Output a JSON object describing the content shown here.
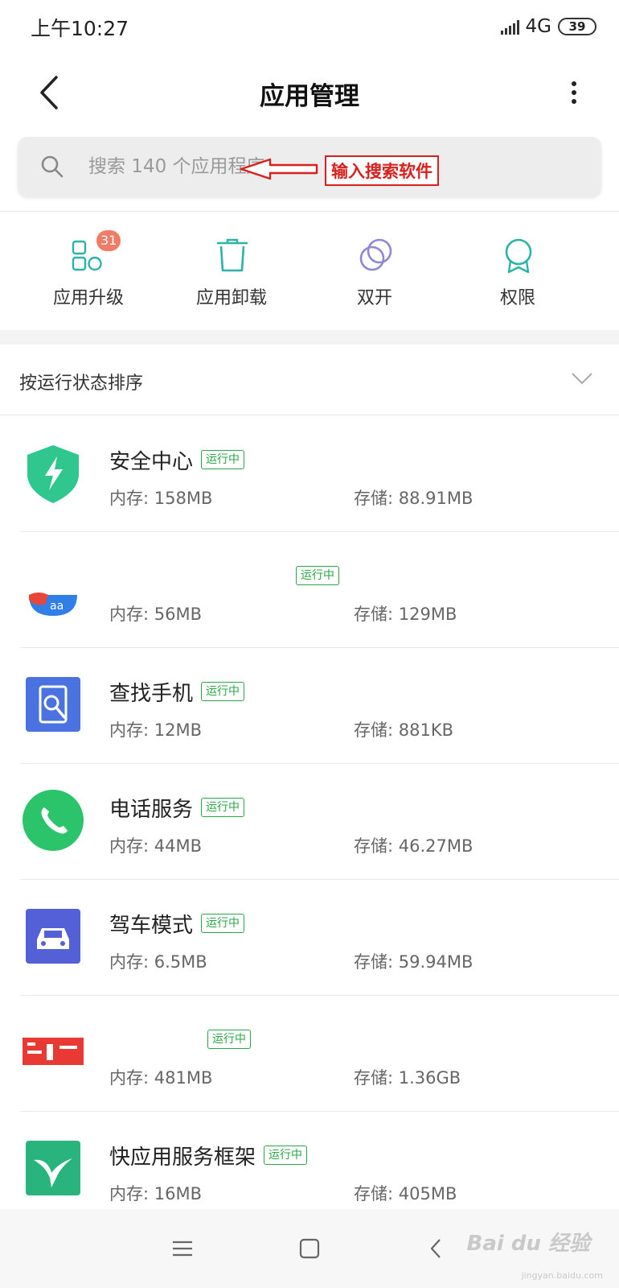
{
  "status_bar": {
    "time": "上午10:27",
    "network": "4G",
    "battery": "39"
  },
  "header": {
    "title": "应用管理"
  },
  "search": {
    "placeholder": "搜索 140 个应用程序"
  },
  "annotation": {
    "label": "输入搜索软件",
    "color": "#d9201c"
  },
  "quick_actions": [
    {
      "label": "应用升级",
      "icon": "app-grid-icon",
      "badge": "31"
    },
    {
      "label": "应用卸载",
      "icon": "trash-icon"
    },
    {
      "label": "双开",
      "icon": "dual-circles-icon"
    },
    {
      "label": "权限",
      "icon": "award-ribbon-icon"
    }
  ],
  "sort": {
    "label": "按运行状态排序"
  },
  "apps": [
    {
      "name": "安全中心",
      "status": "运行中",
      "memory": "内存: 158MB",
      "storage": "存储: 88.91MB",
      "icon": "shield-bolt-icon"
    },
    {
      "name": "",
      "status": "运行中",
      "memory": "内存: 56MB",
      "storage": "存储: 129MB",
      "icon": "blurred-app-icon"
    },
    {
      "name": "查找手机",
      "status": "运行中",
      "memory": "内存: 12MB",
      "storage": "存储: 881KB",
      "icon": "find-phone-icon"
    },
    {
      "name": "电话服务",
      "status": "运行中",
      "memory": "内存: 44MB",
      "storage": "存储: 46.27MB",
      "icon": "phone-icon"
    },
    {
      "name": "驾车模式",
      "status": "运行中",
      "memory": "内存: 6.5MB",
      "storage": "存储: 59.94MB",
      "icon": "car-icon"
    },
    {
      "name": "",
      "status": "运行中",
      "memory": "内存: 481MB",
      "storage": "存储: 1.36GB",
      "icon": "blurred-red-app-icon"
    },
    {
      "name": "快应用服务框架",
      "status": "运行中",
      "memory": "内存: 16MB",
      "storage": "存储: 405MB",
      "icon": "hummingbird-icon"
    }
  ],
  "watermark": {
    "text": "Bai du 经验",
    "sub": "jingyan.baidu.com"
  },
  "colors": {
    "accent_teal": "#2bb3a8",
    "running_green": "#27a844",
    "badge_orange": "#f07c66"
  }
}
